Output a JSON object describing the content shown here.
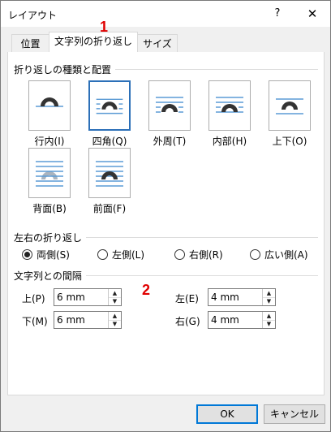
{
  "window": {
    "title": "レイアウト",
    "help_symbol": "?",
    "close_symbol": "✕"
  },
  "annotations": {
    "label_1": "1",
    "label_2": "2",
    "color": "#e00000"
  },
  "tabs": [
    {
      "label": "位置",
      "active": false
    },
    {
      "label": "文字列の折り返し",
      "active": true
    },
    {
      "label": "サイズ",
      "active": false
    }
  ],
  "wrapping_style": {
    "section_title": "折り返しの種類と配置",
    "options": [
      {
        "label": "行内(I)",
        "icon": "inline-with-text-icon",
        "selected": false
      },
      {
        "label": "四角(Q)",
        "icon": "square-wrap-icon",
        "selected": true
      },
      {
        "label": "外周(T)",
        "icon": "tight-wrap-icon",
        "selected": false
      },
      {
        "label": "内部(H)",
        "icon": "through-wrap-icon",
        "selected": false
      },
      {
        "label": "上下(O)",
        "icon": "top-bottom-wrap-icon",
        "selected": false
      },
      {
        "label": "背面(B)",
        "icon": "behind-text-icon",
        "selected": false
      },
      {
        "label": "前面(F)",
        "icon": "in-front-of-text-icon",
        "selected": false
      }
    ]
  },
  "wrap_text": {
    "section_title": "左右の折り返し",
    "options": [
      {
        "label": "両側(S)",
        "checked": true
      },
      {
        "label": "左側(L)",
        "checked": false
      },
      {
        "label": "右側(R)",
        "checked": false
      },
      {
        "label": "広い側(A)",
        "checked": false
      }
    ]
  },
  "distance": {
    "section_title": "文字列との間隔",
    "top": {
      "label": "上(P)",
      "value": "6 mm"
    },
    "bottom": {
      "label": "下(M)",
      "value": "6 mm"
    },
    "left": {
      "label": "左(E)",
      "value": "4 mm"
    },
    "right": {
      "label": "右(G)",
      "value": "4 mm"
    }
  },
  "buttons": {
    "ok": "OK",
    "cancel": "キャンセル"
  },
  "colors": {
    "accent": "#2c70b8",
    "line": "#5b9bd5",
    "shape": "#333333"
  }
}
